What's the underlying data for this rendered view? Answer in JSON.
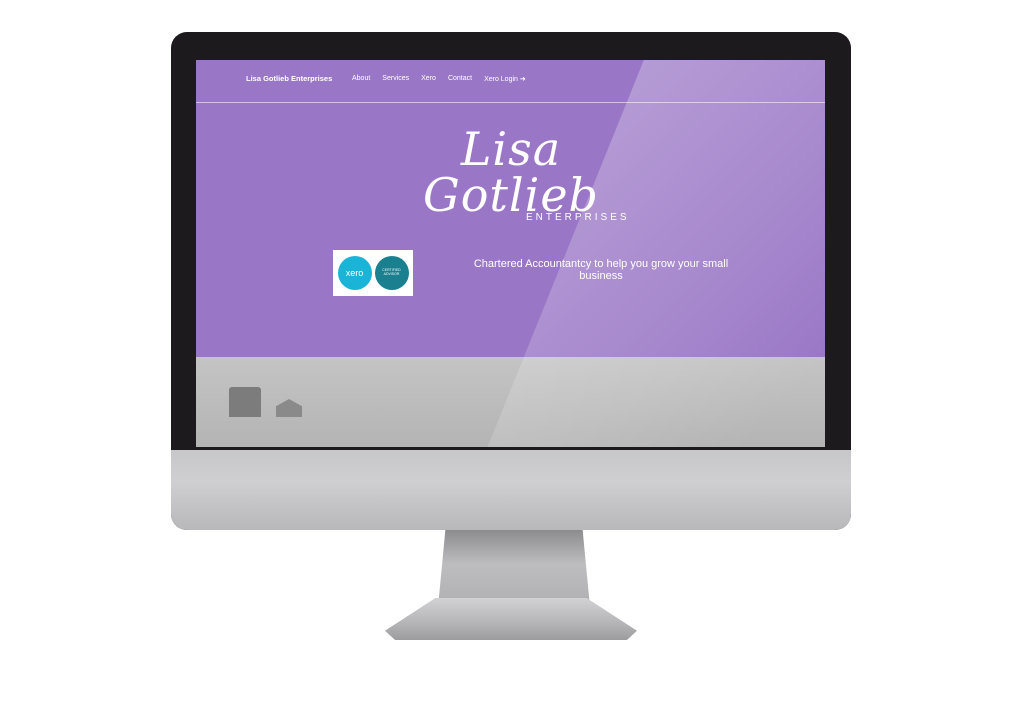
{
  "nav": {
    "brand": "Lisa Gotlieb Enterprises",
    "links": [
      "About",
      "Services",
      "Xero",
      "Contact",
      "Xero Login ➜"
    ]
  },
  "hero": {
    "logo_script": "Lisa Gotlieb",
    "logo_sub": "ENTERPRISES",
    "tagline": "Chartered Accountantcy to help you grow your small business"
  },
  "badge": {
    "xero": "xero",
    "advisor": "CERTIFIED ADVISOR"
  },
  "colors": {
    "hero_bg": "#9a77c6",
    "xero_blue": "#1ab4d7",
    "advisor_teal": "#1a7f8e"
  }
}
